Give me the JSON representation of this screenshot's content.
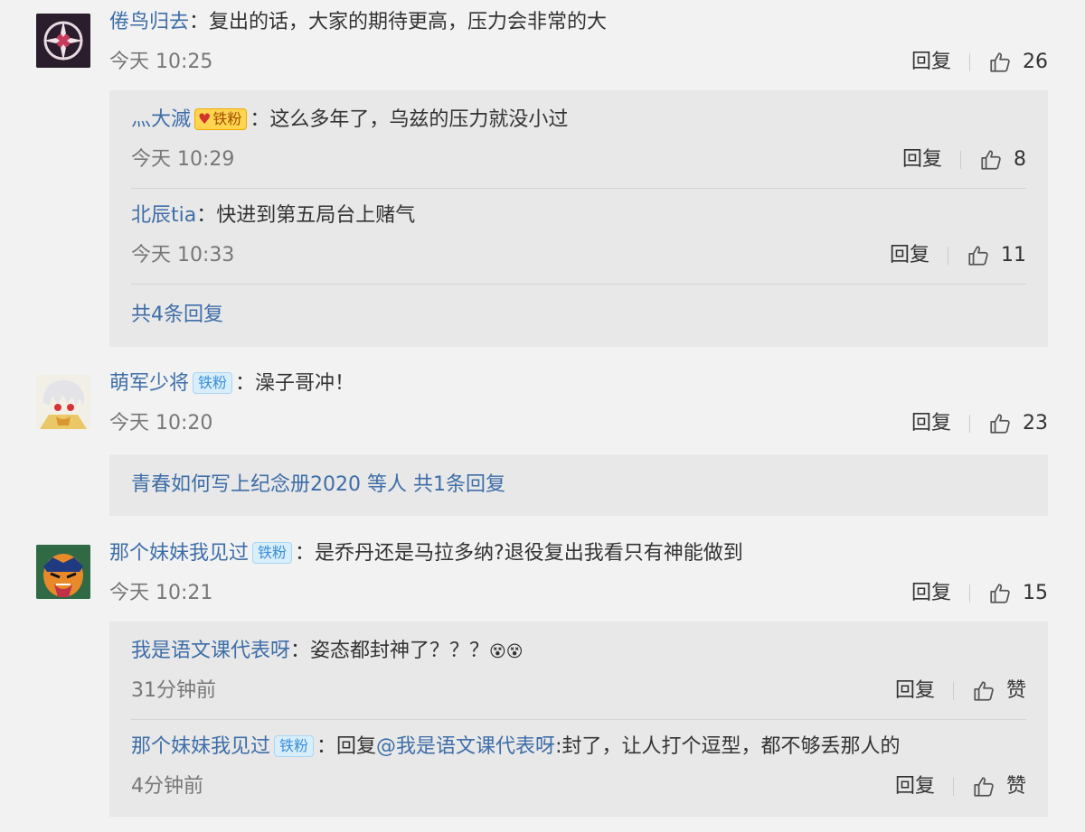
{
  "comments": [
    {
      "user": "倦鸟归去",
      "text": "：复出的话，大家的期待更高，压力会非常的大",
      "time": "今天 10:25",
      "reply_label": "回复",
      "likes": "26",
      "replies": [
        {
          "user": "灬大滅",
          "badge": "铁粉",
          "text": "：这么多年了，乌兹的压力就没小过",
          "time": "今天 10:29",
          "reply_label": "回复",
          "likes": "8"
        },
        {
          "user": "北辰tia",
          "text": "：快进到第五局台上赌气",
          "time": "今天 10:33",
          "reply_label": "回复",
          "likes": "11"
        }
      ],
      "more_replies": "共4条回复"
    },
    {
      "user": "萌军少将",
      "badge": "铁粉",
      "text": "：澡子哥冲！",
      "time": "今天 10:20",
      "reply_label": "回复",
      "likes": "23",
      "summary": {
        "user": "青春如何写上纪念册2020",
        "others": "等人",
        "count": "共1条回复"
      }
    },
    {
      "user": "那个妹妹我见过",
      "badge": "铁粉",
      "text": "：是乔丹还是马拉多纳?退役复出我看只有神能做到",
      "time": "今天 10:21",
      "reply_label": "回复",
      "likes": "15",
      "replies": [
        {
          "user": "我是语文课代表呀",
          "text": "：姿态都封神了？？？",
          "emoji": "😵😵",
          "time": "31分钟前",
          "reply_label": "回复",
          "likes": "赞"
        },
        {
          "user": "那个妹妹我见过",
          "badge": "铁粉",
          "text_prefix": "：回复",
          "mention": "@我是语文课代表呀",
          "text": ":封了，让人打个逗型，都不够丢那人的",
          "time": "4分钟前",
          "reply_label": "回复",
          "likes": "赞"
        }
      ]
    }
  ]
}
